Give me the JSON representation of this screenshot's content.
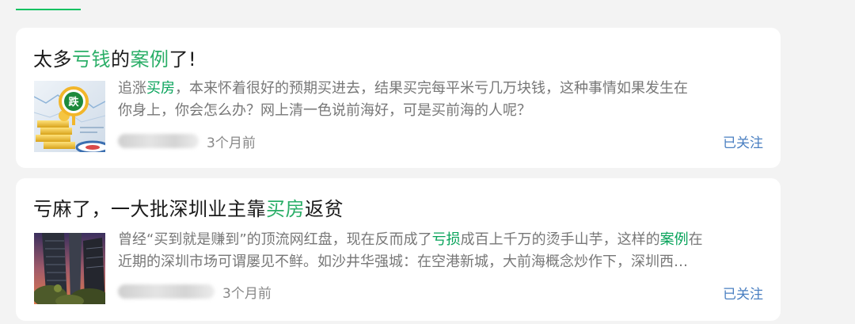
{
  "colors": {
    "accent_green": "#07c160",
    "keyword_green": "#07a35a",
    "link_blue": "#4a7fc1",
    "text_dark": "#1a1a1a",
    "text_gray": "#777777"
  },
  "articles": [
    {
      "title_parts": [
        "太多",
        "亏钱",
        "的",
        "案例",
        "了!"
      ],
      "summary_parts": [
        "追涨",
        "买房",
        "，本来怀着很好的预期买进去，结果买完每平米亏几万块钱，这种事情如果发生在\n你身上，你会怎么办？网上清一色说前海好，可是买前海的人呢？"
      ],
      "time": "3个月前",
      "follow_label": "已关注",
      "thumb_badge": "跌"
    },
    {
      "title_parts": [
        "亏麻了，一大批深圳业主靠",
        "买房",
        "返贫"
      ],
      "summary_parts": [
        "曾经“买到就是赚到”的顶流网红盘，现在反而成了",
        "亏损",
        "成百上千万的烫手山芋，这样的",
        "案例",
        "在\n近期的深圳市场可谓屡见不鲜。如沙井华强城：在空港新城，大前海概念炒作下，深圳西…"
      ],
      "time": "3个月前",
      "follow_label": "已关注"
    }
  ]
}
